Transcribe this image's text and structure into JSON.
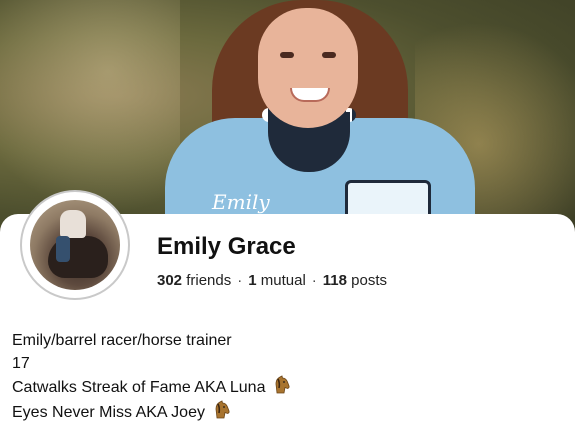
{
  "profile": {
    "name": "Emily Grace",
    "jacket_script": "Emily",
    "stats": {
      "friends_count": "302",
      "friends_label": "friends",
      "mutual_count": "1",
      "mutual_label": "mutual",
      "posts_count": "118",
      "posts_label": "posts",
      "separator": "·"
    },
    "bio": {
      "line1": "Emily/barrel racer/horse trainer",
      "line2": "17",
      "line3": "Catwalks Streak of Fame AKA Luna",
      "line4": "Eyes Never Miss AKA Joey"
    }
  },
  "icons": {
    "bio_line3_icon": "horse-face-icon",
    "bio_line4_icon": "horse-face-icon"
  },
  "colors": {
    "jacket_blue": "#8ec0e0",
    "text": "#111111",
    "avatar_ring": "#c9c9c9"
  }
}
